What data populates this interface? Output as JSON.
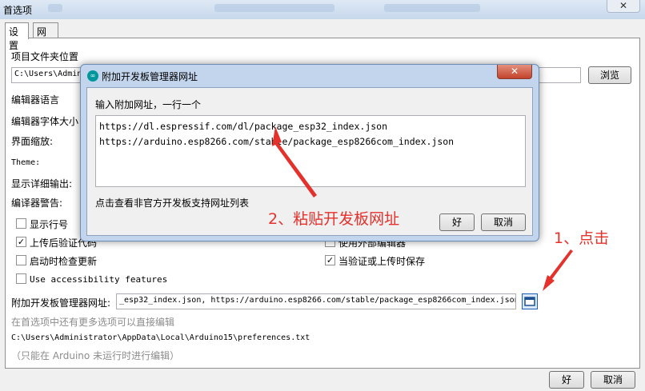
{
  "window": {
    "title": "首选项",
    "close_label": "✕"
  },
  "tabs": [
    {
      "label": "设置"
    },
    {
      "label": "网络"
    }
  ],
  "settings": {
    "sketchbook_label": "项目文件夹位置",
    "sketchbook_path": "C:\\Users\\Admini",
    "browse_label": "浏览",
    "editor_language": "编辑器语言",
    "editor_font_size": "编辑器字体大小",
    "interface_scale": "界面缩放:",
    "theme": "Theme:",
    "verbose_output": "显示详细输出:",
    "compiler_warnings": "编译器警告:",
    "show_line_numbers": "显示行号",
    "verify_after_upload": "上传后验证代码",
    "check_updates": "启动时检查更新",
    "use_external_editor": "使用外部编辑器",
    "save_on_verify": "当验证或上传时保存",
    "accessibility": "Use accessibility features",
    "boards_url_label": "附加开发板管理器网址:",
    "boards_url_value": "_esp32_index.json, https://arduino.esp8266.com/stable/package_esp8266com_index.json",
    "more_prefs_note": "在首选项中还有更多选项可以直接编辑",
    "prefs_path": "C:\\Users\\Administrator\\AppData\\Local\\Arduino15\\preferences.txt",
    "edit_note": "（只能在 Arduino 未运行时进行编辑）"
  },
  "footer": {
    "ok_label": "好",
    "cancel_label": "取消"
  },
  "dialog": {
    "title": "附加开发板管理器网址",
    "icon_text": "∞",
    "instruction": "输入附加网址，一行一个",
    "urls": [
      "https://dl.espressif.com/dl/package_esp32_index.json",
      "https://arduino.esp8266.com/stable/package_esp8266com_index.json"
    ],
    "link_text": "点击查看非官方开发板支持网址列表",
    "ok_label": "好",
    "cancel_label": "取消",
    "close_label": "✕"
  },
  "annotations": {
    "step1": "1、点击",
    "step2": "2、粘贴开发板网址",
    "color": "#e5312c"
  }
}
